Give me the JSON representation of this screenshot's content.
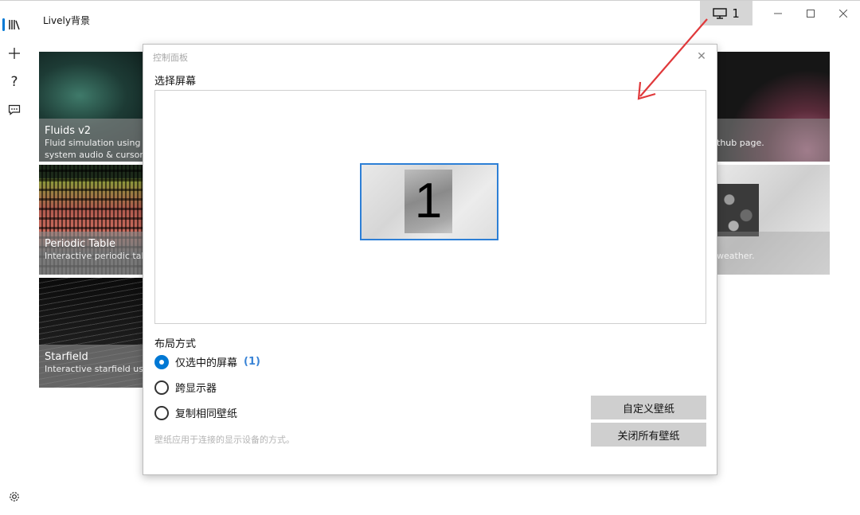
{
  "app": {
    "title": "Lively背景"
  },
  "titlebar": {
    "monitor_label": "1"
  },
  "rail": {
    "items": [
      {
        "name": "library-icon",
        "active": true
      },
      {
        "name": "add-icon"
      },
      {
        "name": "help-icon"
      },
      {
        "name": "feedback-icon"
      },
      {
        "name": "settings-icon"
      }
    ]
  },
  "wallpapers": [
    {
      "name": "Fluids v2",
      "desc1": "Fluid simulation using W",
      "desc2": "system audio & cursor."
    },
    {
      "name": "Periodic Table",
      "desc1": "Interactive periodic table",
      "desc2": ""
    },
    {
      "name": "Starfield",
      "desc1": "Interactive starfield using",
      "desc2": ""
    }
  ],
  "wallpapers_right": [
    {
      "desc": "thub page."
    },
    {
      "desc": "weather."
    }
  ],
  "dialog": {
    "title": "控制面板",
    "select_screen_label": "选择屏幕",
    "screen_number": "1",
    "layout_label": "布局方式",
    "options": [
      {
        "label": "仅选中的屏幕",
        "badge": "(1)",
        "checked": true
      },
      {
        "label": "跨显示器",
        "badge": "",
        "checked": false
      },
      {
        "label": "复制相同壁纸",
        "badge": "",
        "checked": false
      }
    ],
    "hint": "壁纸应用于连接的显示设备的方式。",
    "custom_button": "自定义壁纸",
    "close_all_button": "关闭所有壁纸"
  },
  "colors": {
    "accent": "#0078d4",
    "arrow": "#e0393b"
  }
}
